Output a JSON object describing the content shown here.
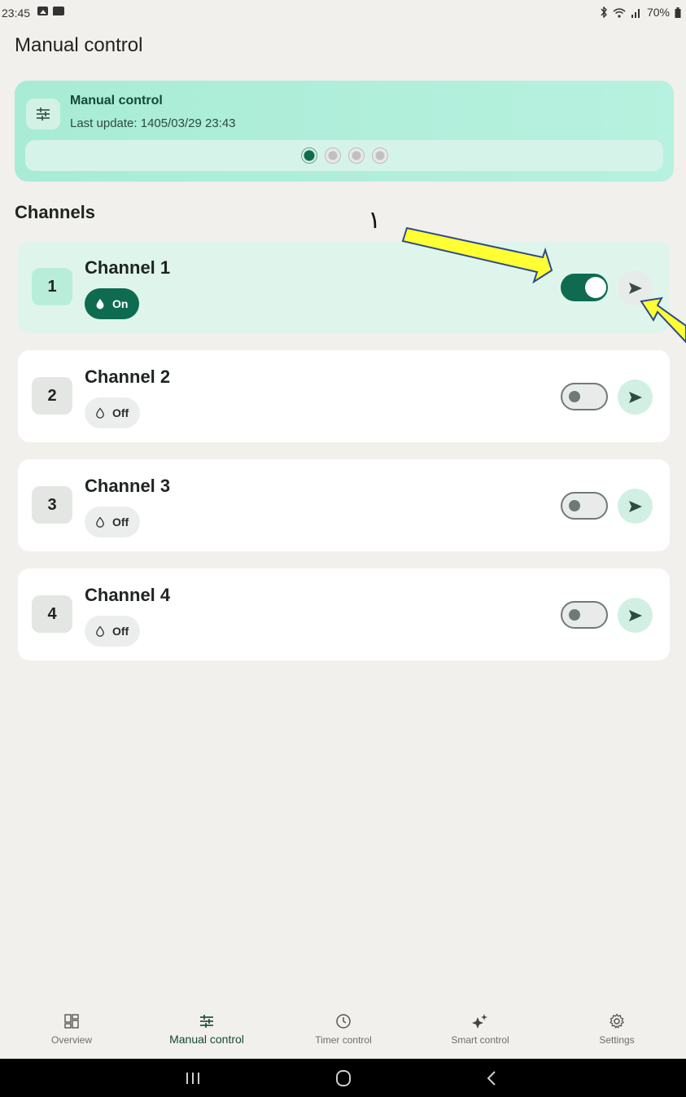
{
  "status_bar": {
    "time": "23:45",
    "battery": "70%",
    "icons": [
      "gallery-icon",
      "message-icon",
      "bluetooth-icon",
      "wifi-icon",
      "signal-icon",
      "battery-icon"
    ]
  },
  "page_title": "Manual control",
  "hero": {
    "title": "Manual control",
    "subtitle": "Last update: 1405/03/29 23:43",
    "icon": "sliders-icon",
    "page_dots": {
      "count": 4,
      "active": 1
    }
  },
  "section_title": "Channels",
  "annotation": {
    "label": "١",
    "arrow_color": "#ffff33"
  },
  "channels": [
    {
      "number": "1",
      "name": "Channel 1",
      "status": "On",
      "on": true
    },
    {
      "number": "2",
      "name": "Channel 2",
      "status": "Off",
      "on": false
    },
    {
      "number": "3",
      "name": "Channel 3",
      "status": "Off",
      "on": false
    },
    {
      "number": "4",
      "name": "Channel 4",
      "status": "Off",
      "on": false
    }
  ],
  "bottom_nav": [
    {
      "label": "Overview",
      "icon": "grid-icon",
      "active": false
    },
    {
      "label": "Manual control",
      "icon": "sliders-icon",
      "active": true
    },
    {
      "label": "Timer control",
      "icon": "clock-icon",
      "active": false
    },
    {
      "label": "Smart control",
      "icon": "sparkle-icon",
      "active": false
    },
    {
      "label": "Settings",
      "icon": "gear-icon",
      "active": false
    }
  ],
  "colors": {
    "accent": "#0f6b4f",
    "hero_bg": "#a8ecd5",
    "active_card_bg": "#dff5ec",
    "page_bg": "#f1f0ec"
  }
}
